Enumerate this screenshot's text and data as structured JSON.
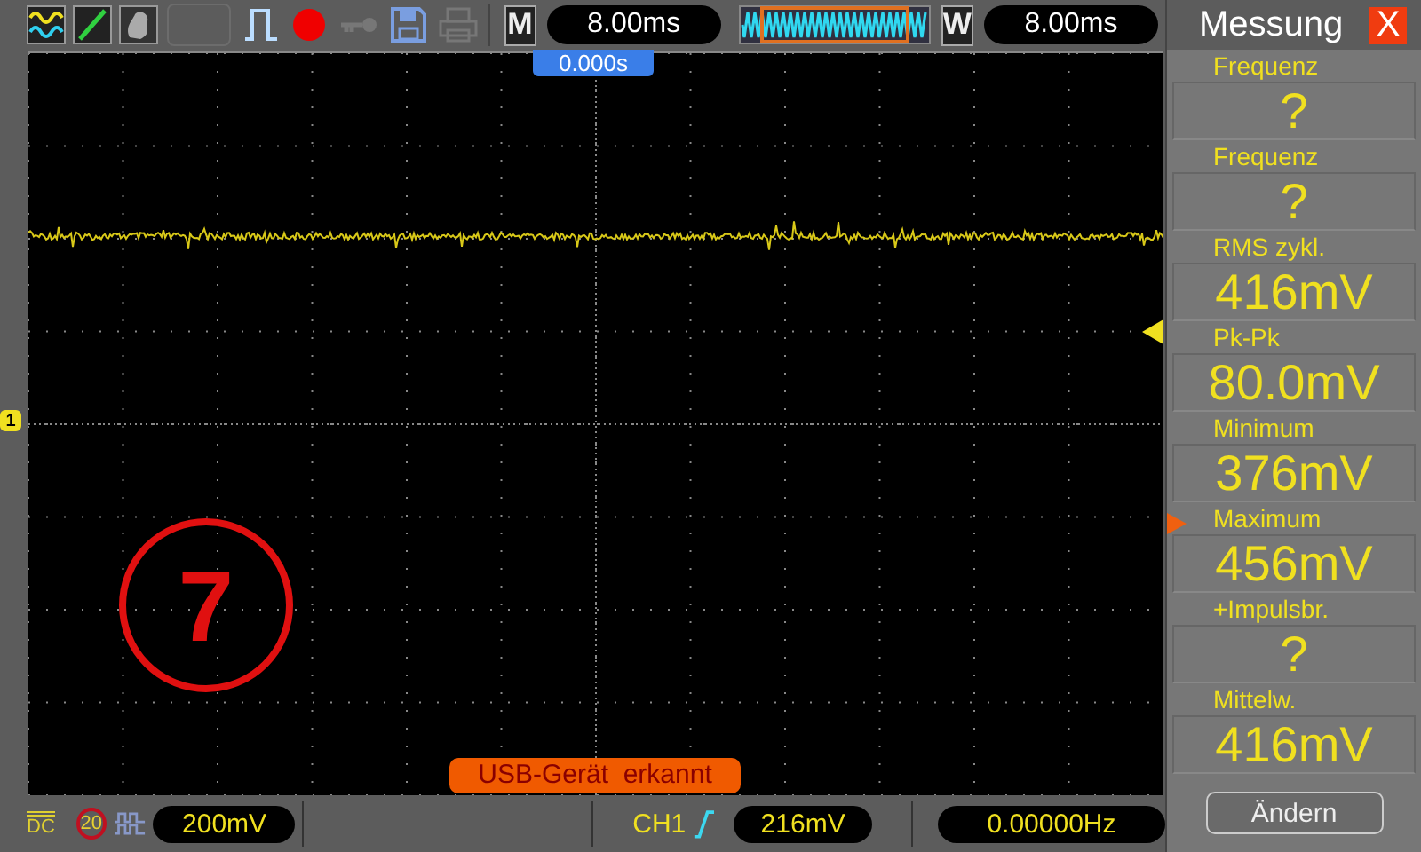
{
  "toolbar": {
    "mode_label": "M",
    "timebase": "8.00ms",
    "window_label": "W",
    "window_time": "8.00ms"
  },
  "plot": {
    "time_offset": "0.000s",
    "channel_marker": "1",
    "annotation": "7",
    "notification": "USB-Gerät  erkannt"
  },
  "measure_panel": {
    "title": "Messung",
    "close": "X",
    "measurements": [
      {
        "label": "Frequenz",
        "value": "?",
        "selected": false
      },
      {
        "label": "Frequenz",
        "value": "?",
        "selected": false
      },
      {
        "label": "RMS  zykl.",
        "value": "416mV",
        "selected": false
      },
      {
        "label": "Pk-Pk",
        "value": "80.0mV",
        "selected": false
      },
      {
        "label": "Minimum",
        "value": "376mV",
        "selected": false
      },
      {
        "label": "Maximum",
        "value": "456mV",
        "selected": true
      },
      {
        "label": "+Impulsbr.",
        "value": "?",
        "selected": false
      },
      {
        "label": "Mittelw.",
        "value": "416mV",
        "selected": false
      }
    ],
    "button": "Ändern"
  },
  "status_bar": {
    "coupling": "DC",
    "bandwidth_limit": "20",
    "volts_div": "200mV",
    "channel": "CH1",
    "trigger_level": "216mV",
    "frequency": "0.00000Hz"
  }
}
